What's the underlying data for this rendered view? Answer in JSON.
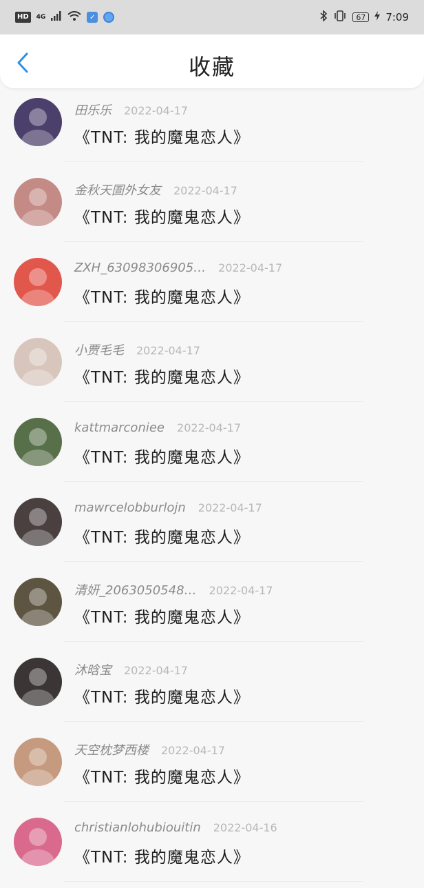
{
  "status_bar": {
    "hd": "HD",
    "network": "4G",
    "battery": "67",
    "time": "7:09"
  },
  "header": {
    "title": "收藏",
    "back_icon": "chevron-left-icon"
  },
  "favorites": [
    {
      "user": "田乐乐",
      "date": "2022-04-17",
      "title": "《TNT: 我的魔鬼恋人》",
      "avatar_color": "#4b3f6b"
    },
    {
      "user": "金秋天圄外女友",
      "date": "2022-04-17",
      "title": "《TNT: 我的魔鬼恋人》",
      "avatar_color": "#c48a86"
    },
    {
      "user": "ZXH_63098306905…",
      "date": "2022-04-17",
      "title": "《TNT: 我的魔鬼恋人》",
      "avatar_color": "#e2574c"
    },
    {
      "user": "小贾毛毛",
      "date": "2022-04-17",
      "title": "《TNT: 我的魔鬼恋人》",
      "avatar_color": "#d8c6bd"
    },
    {
      "user": "kattmarconiee",
      "date": "2022-04-17",
      "title": "《TNT: 我的魔鬼恋人》",
      "avatar_color": "#58704a"
    },
    {
      "user": "mawrcelobburlojn",
      "date": "2022-04-17",
      "title": "《TNT: 我的魔鬼恋人》",
      "avatar_color": "#4a4040"
    },
    {
      "user": "清妍_2063050548…",
      "date": "2022-04-17",
      "title": "《TNT: 我的魔鬼恋人》",
      "avatar_color": "#5e5442"
    },
    {
      "user": "沐晗宝",
      "date": "2022-04-17",
      "title": "《TNT: 我的魔鬼恋人》",
      "avatar_color": "#3b3535"
    },
    {
      "user": "天空枕梦西楼",
      "date": "2022-04-17",
      "title": "《TNT: 我的魔鬼恋人》",
      "avatar_color": "#c59a7e"
    },
    {
      "user": "christianlohubiouitin",
      "date": "2022-04-16",
      "title": "《TNT: 我的魔鬼恋人》",
      "avatar_color": "#d96a8e"
    }
  ]
}
